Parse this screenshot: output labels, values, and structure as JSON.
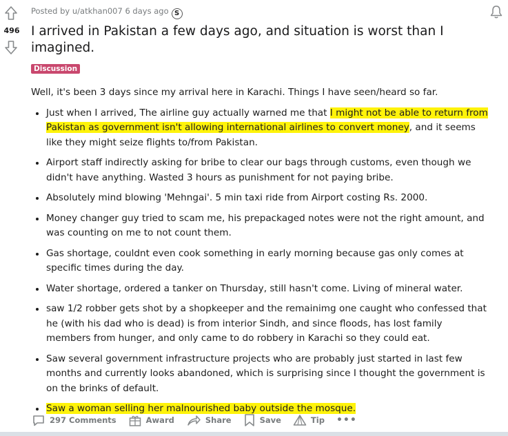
{
  "post": {
    "vote_count": "496",
    "meta_text": "Posted by u/atkhan007 6 days ago",
    "title": "I arrived in Pakistan a few days ago, and situation is worst than I imagined.",
    "flair": "Discussion",
    "flair_color": "#c9486e",
    "highlight_color": "#fff30a",
    "intro": "Well, it's been 3 days since my arrival here in Karachi. Things I have seen/heard so far.",
    "bullets": [
      {
        "pre": "Just when I arrived, The airline guy actually warned me that ",
        "hl": "I might not be able to return from Pakistan as government isn't allowing international airlines to convert money",
        "post": ", and it seems like they might seize flights to/from Pakistan."
      },
      {
        "pre": "Airport staff indirectly asking for bribe to clear our bags through customs, even though we didn't have anything. Wasted 3 hours as punishment for not paying bribe.",
        "hl": "",
        "post": ""
      },
      {
        "pre": "Absolutely mind blowing 'Mehngai'. 5 min taxi ride from Airport costing Rs. 2000.",
        "hl": "",
        "post": ""
      },
      {
        "pre": "Money changer guy tried to scam me, his prepackaged notes were not the right amount, and was counting on me to not count them.",
        "hl": "",
        "post": ""
      },
      {
        "pre": "Gas shortage, couldnt even cook something in early morning because gas only comes at specific times during the day.",
        "hl": "",
        "post": ""
      },
      {
        "pre": "Water shortage, ordered a tanker on Thursday, still hasn't come. Living of mineral water.",
        "hl": "",
        "post": ""
      },
      {
        "pre": "saw 1/2 robber gets shot by a shopkeeper and the remainimg one caught who confessed that he (with his dad who is dead) is from interior Sindh, and since floods, has lost family members from hunger, and only came to do robbery in Karachi so they could eat.",
        "hl": "",
        "post": ""
      },
      {
        "pre": "Saw several government infrastructure projects who are probably just started in last few months and currently looks abandoned, which is surprising since I thought the government is on the brinks of default.",
        "hl": "",
        "post": ""
      },
      {
        "pre": "",
        "hl": "Saw a woman selling her malnourished baby outside the mosque.",
        "post": ""
      }
    ]
  },
  "actions": {
    "comments": "297 Comments",
    "award": "Award",
    "share": "Share",
    "save": "Save",
    "tip": "Tip",
    "more": "•••"
  },
  "icons": {
    "upvote": "upvote-arrow-icon",
    "downvote": "downvote-arrow-icon",
    "award_badge": "award-badge-icon",
    "bell": "bell-icon",
    "comment": "comment-icon",
    "award": "gift-award-icon",
    "share": "share-arrow-icon",
    "save": "bookmark-icon",
    "tip": "tip-triangle-icon"
  }
}
